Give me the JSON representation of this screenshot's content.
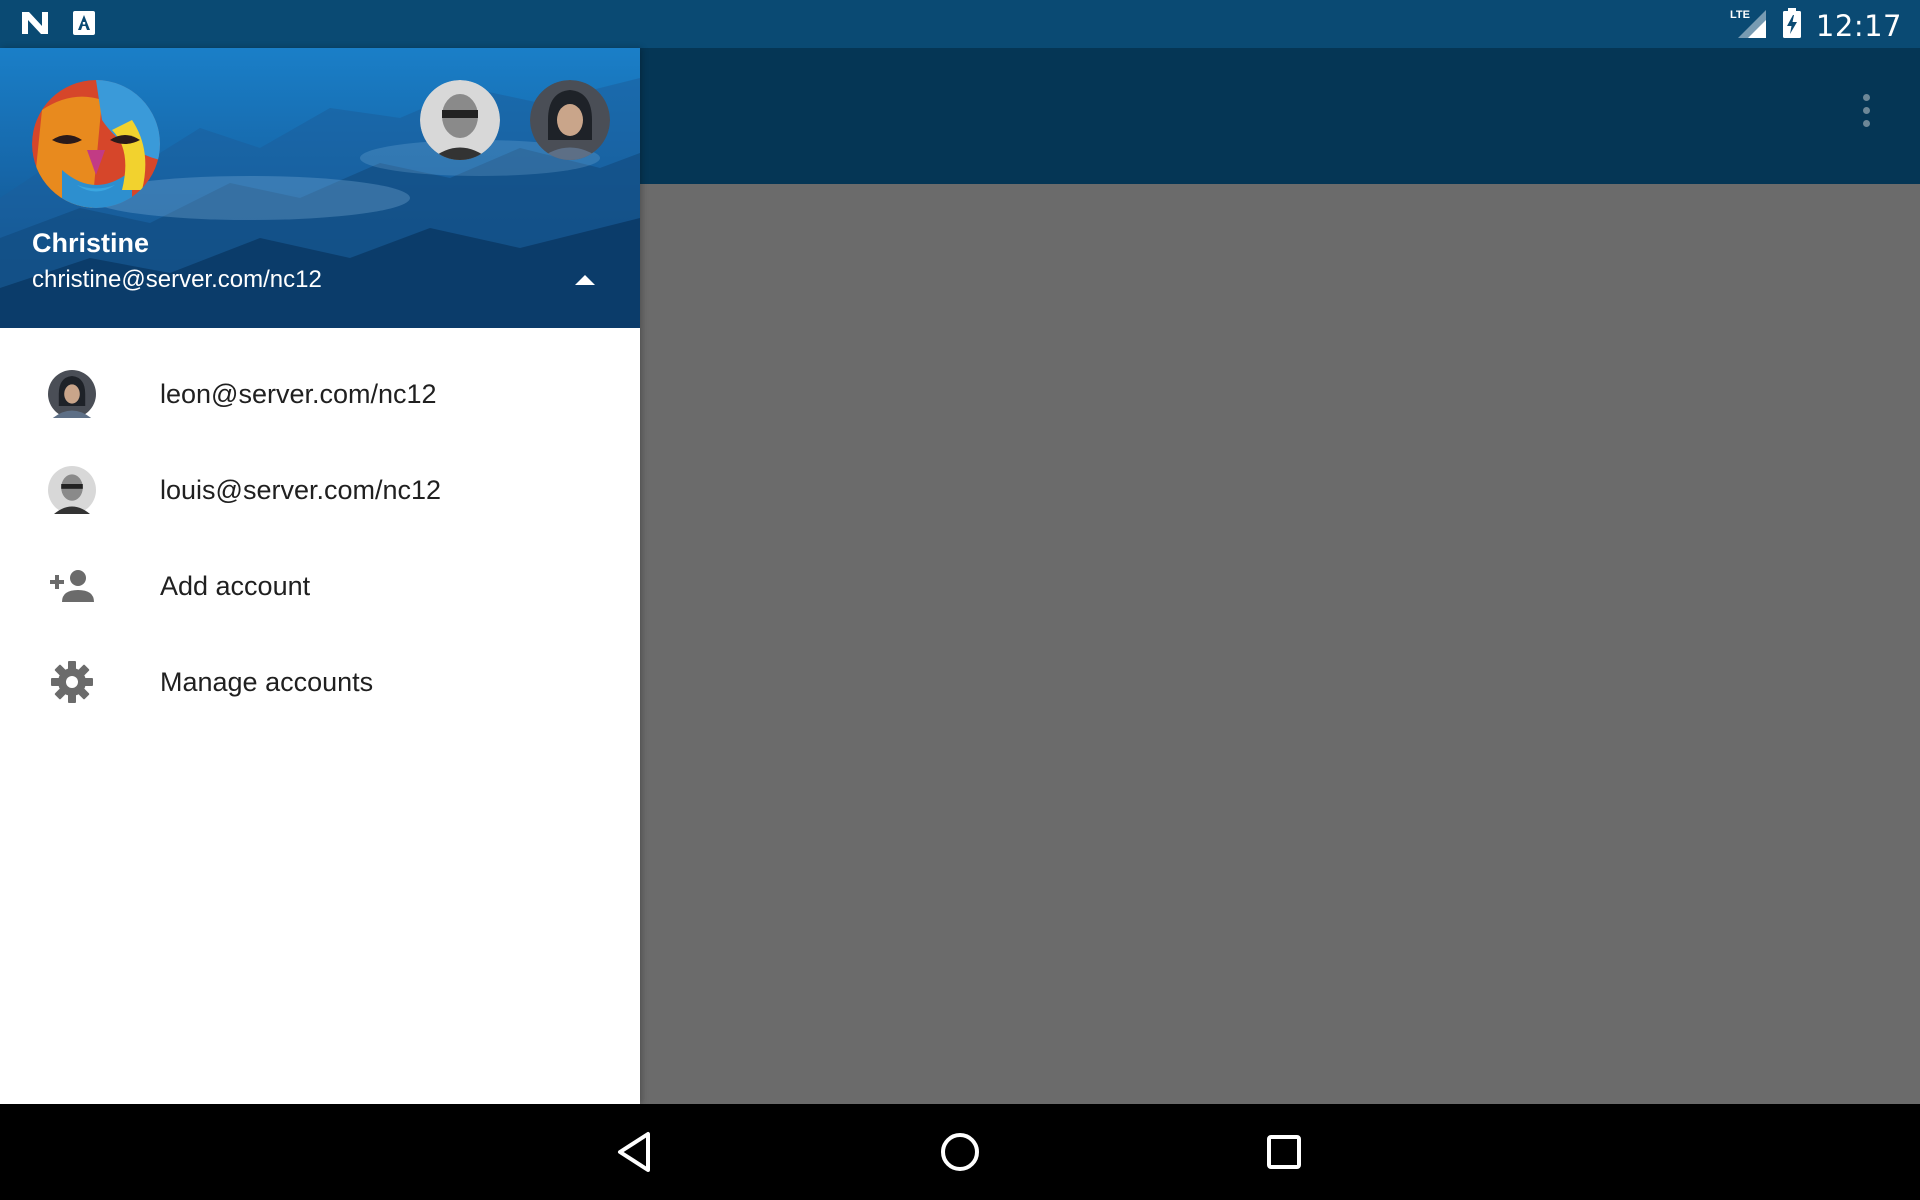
{
  "status_bar": {
    "left_icons": [
      "n-logo-icon",
      "a-notification-icon"
    ],
    "right_icons": [
      "lte-signal-icon",
      "battery-charging-icon"
    ],
    "network_label": "LTE",
    "time": "12:17"
  },
  "drawer": {
    "current_account": {
      "name": "Christine",
      "email": "christine@server.com/nc12",
      "avatar": "christine-avatar"
    },
    "other_avatars": [
      "louis-avatar",
      "leon-avatar"
    ],
    "toggle_icon": "arrow-up-icon",
    "menu_items": [
      {
        "label": "leon@server.com/nc12",
        "icon": "leon-avatar"
      },
      {
        "label": "louis@server.com/nc12",
        "icon": "louis-avatar"
      },
      {
        "label": "Add account",
        "icon": "person-add-icon"
      },
      {
        "label": "Manage accounts",
        "icon": "gear-icon"
      }
    ]
  },
  "toolbar": {
    "overflow_icon": "more-vert-icon"
  },
  "nav_bar": {
    "buttons": [
      "back-icon",
      "home-icon",
      "recents-icon"
    ]
  },
  "colors": {
    "status_bar": "#0a4a73",
    "toolbar": "#053655",
    "scrim": "#6b6b6b",
    "drawer_bg": "#ffffff",
    "nav_bar": "#000000",
    "icon_gray": "#6b6b6b"
  }
}
